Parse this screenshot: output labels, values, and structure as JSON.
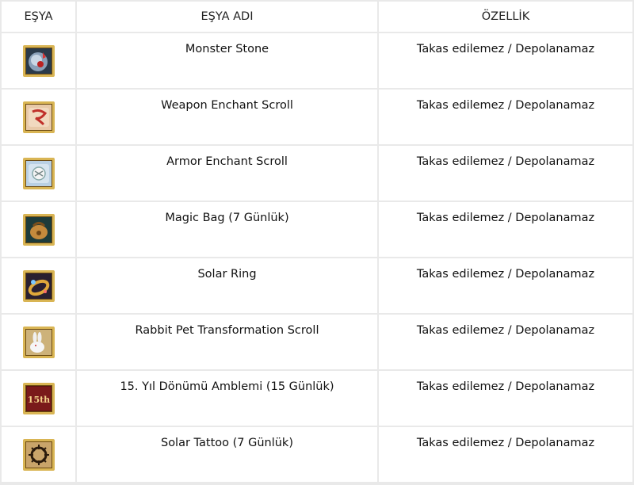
{
  "headers": {
    "item": "EŞYA",
    "name": "EŞYA ADI",
    "feature": "ÖZELLİK"
  },
  "rows": [
    {
      "icon": "monster-stone-icon",
      "name": "Monster Stone",
      "feature": "Takas edilemez / Depolanamaz"
    },
    {
      "icon": "weapon-enchant-scroll-icon",
      "name": "Weapon Enchant Scroll",
      "feature": "Takas edilemez / Depolanamaz"
    },
    {
      "icon": "armor-enchant-scroll-icon",
      "name": "Armor Enchant Scroll",
      "feature": "Takas edilemez / Depolanamaz"
    },
    {
      "icon": "magic-bag-icon",
      "name": "Magic Bag (7 Günlük)",
      "feature": "Takas edilemez / Depolanamaz"
    },
    {
      "icon": "solar-ring-icon",
      "name": "Solar Ring",
      "feature": "Takas edilemez / Depolanamaz"
    },
    {
      "icon": "rabbit-icon",
      "name": "Rabbit Pet Transformation Scroll",
      "feature": "Takas edilemez / Depolanamaz"
    },
    {
      "icon": "anniversary-emblem-icon",
      "name": "15. Yıl Dönümü Amblemi (15 Günlük)",
      "feature": "Takas edilemez / Depolanamaz",
      "badge": "15th"
    },
    {
      "icon": "solar-tattoo-icon",
      "name": "Solar Tattoo (7 Günlük)",
      "feature": "Takas edilemez / Depolanamaz"
    }
  ]
}
